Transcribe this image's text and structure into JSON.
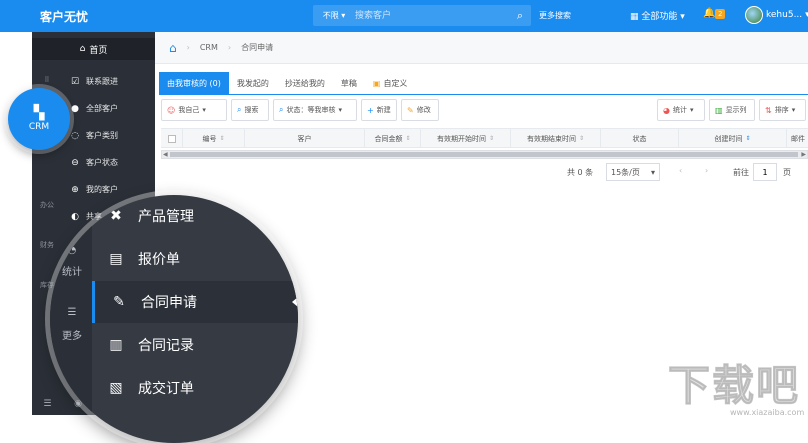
{
  "topbar": {
    "app_title": "客户无忧",
    "search_scope": "不限",
    "search_placeholder": "搜索客户",
    "more_search": "更多搜索",
    "all_functions": "全部功能",
    "notification_count": "2",
    "username": "kehu5..."
  },
  "sidebar": {
    "home_label": "首页",
    "crm_label": "CRM",
    "mini": [
      "办公",
      "财务",
      "库存"
    ],
    "items": [
      {
        "label": "联系跟进",
        "icon": "checkbox-icon"
      },
      {
        "label": "全部客户",
        "icon": "user-icon"
      },
      {
        "label": "客户类别",
        "icon": "circle-chevron-icon"
      },
      {
        "label": "客户状态",
        "icon": "circle-dash-icon"
      },
      {
        "label": "我的客户",
        "icon": "lock-user-icon"
      },
      {
        "label": "共享",
        "icon": "share-user-icon"
      }
    ]
  },
  "zoom_menu": {
    "left_labels": [
      "统计",
      "更多"
    ],
    "items": [
      {
        "label": "产品管理",
        "icon": "wrench-icon"
      },
      {
        "label": "报价单",
        "icon": "quote-doc-icon"
      },
      {
        "label": "合同申请",
        "icon": "contract-edit-icon",
        "active": true
      },
      {
        "label": "合同记录",
        "icon": "contract-record-icon"
      },
      {
        "label": "成交订单",
        "icon": "order-icon"
      }
    ]
  },
  "breadcrumb": {
    "module": "CRM",
    "page": "合同申请"
  },
  "tabs": [
    {
      "label": "由我审核的 (0)",
      "active": true
    },
    {
      "label": "我发起的"
    },
    {
      "label": "抄送给我的"
    },
    {
      "label": "草稿"
    },
    {
      "label": "自定义"
    }
  ],
  "toolbar": {
    "scope": "我自己",
    "search": "搜索",
    "status_filter": "状态：等我审核",
    "new": "新建",
    "edit": "修改",
    "stats": "统计",
    "columns": "显示列",
    "sort": "排序"
  },
  "table": {
    "columns": [
      "编号",
      "客户",
      "合同金额",
      "有效期开始时间",
      "有效期结束时间",
      "状态",
      "创建时间",
      "邮件"
    ]
  },
  "pager": {
    "total": "共 0 条",
    "page_size": "15条/页",
    "goto_label": "前往",
    "page_value": "1",
    "page_unit": "页"
  },
  "watermark": {
    "big": "下载吧",
    "small": "www.xiazaiba.com"
  },
  "colors": {
    "accent": "#1a8cf0",
    "sidebar": "#2b3038"
  }
}
